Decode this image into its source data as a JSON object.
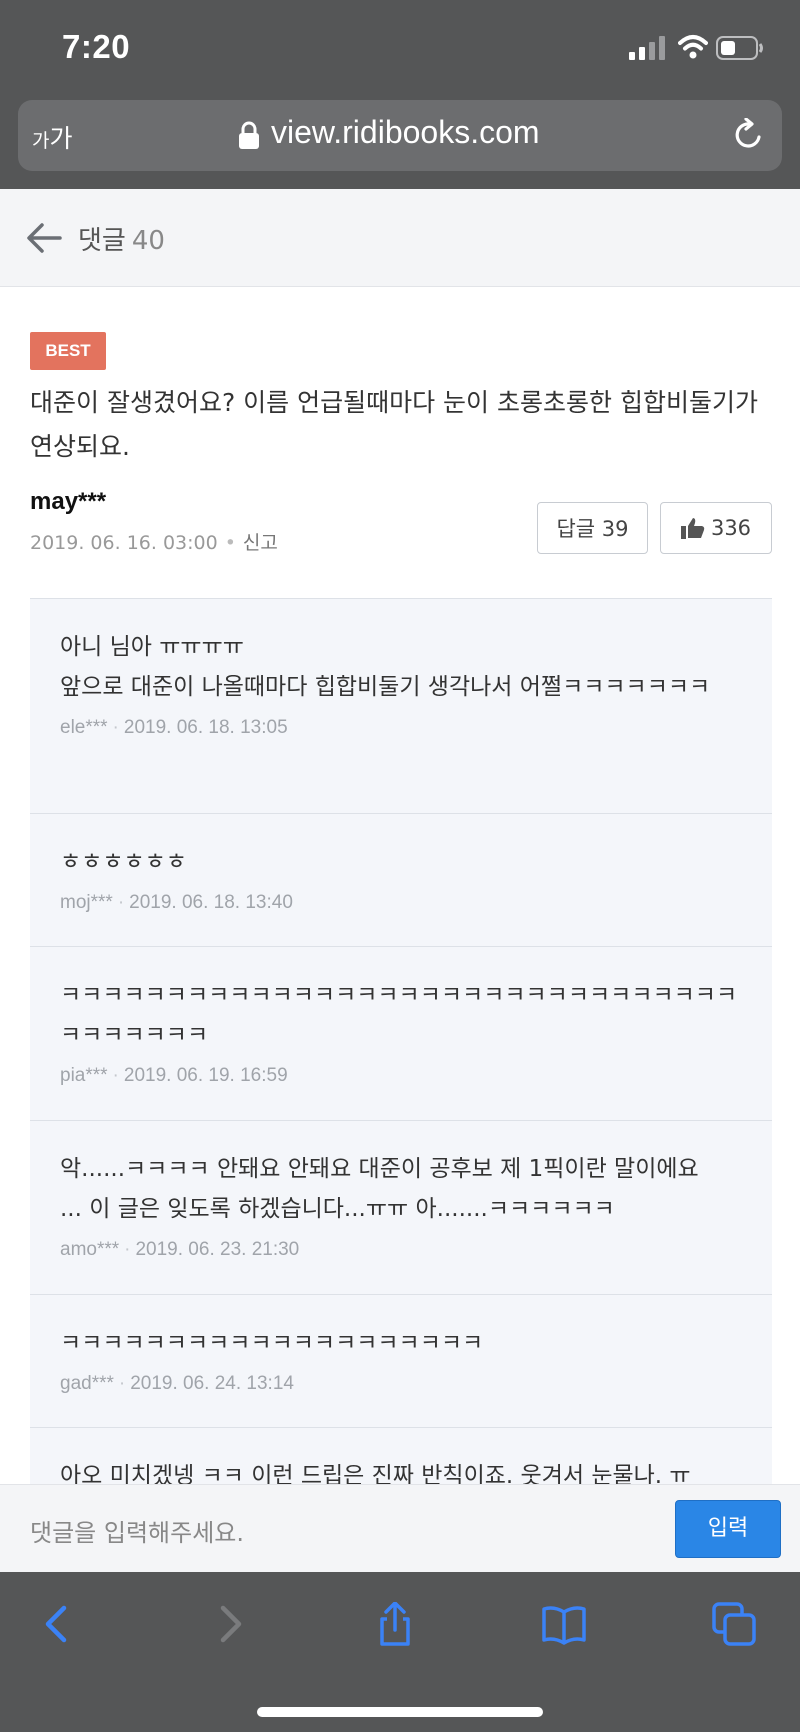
{
  "status_bar": {
    "time": "7:20"
  },
  "browser": {
    "font_size_label_small": "가",
    "font_size_label_large": "가",
    "url": "view.ridibooks.com"
  },
  "header": {
    "title": "댓글",
    "count": "40"
  },
  "best_comment": {
    "badge": "BEST",
    "text": "대준이 잘생겼어요? 이름 언급될때마다 눈이 초롱초롱한 힙합비둘기가 연상되요.",
    "user": "may***",
    "date": "2019. 06. 16. 03:00",
    "separator": "•",
    "report": "신고",
    "reply_label": "답글 39",
    "like_count": "336"
  },
  "replies": [
    {
      "text_line1": "아니 님아 ㅠㅠㅠㅠ",
      "text_line2": "앞으로 대준이 나올때마다 힙합비둘기 생각나서 어쩔ㅋㅋㅋㅋㅋㅋㅋ",
      "user": "ele***",
      "date": "2019. 06. 18. 13:05"
    },
    {
      "text_line1": "ㅎㅎㅎㅎㅎㅎ",
      "text_line2": "",
      "user": "moj***",
      "date": "2019. 06. 18. 13:40"
    },
    {
      "text_line1": "ㅋㅋㅋㅋㅋㅋㅋㅋㅋㅋㅋㅋㅋㅋㅋㅋㅋㅋㅋㅋㅋㅋㅋㅋㅋㅋㅋㅋㅋㅋㅋㅋㅋㅋㅋㅋㅋㅋㅋ",
      "text_line2": "",
      "user": "pia***",
      "date": "2019. 06. 19. 16:59"
    },
    {
      "text_line1": "악......ㅋㅋㅋㅋ 안돼요 안돼요 대준이 공후보 제 1픽이란 말이에요",
      "text_line2": "... 이 글은 잊도록 하겠습니다...ㅠㅠ 아.......ㅋㅋㅋㅋㅋㅋ",
      "user": "amo***",
      "date": "2019. 06. 23. 21:30"
    },
    {
      "text_line1": "ㅋㅋㅋㅋㅋㅋㅋㅋㅋㅋㅋㅋㅋㅋㅋㅋㅋㅋㅋㅋ",
      "text_line2": "",
      "user": "gad***",
      "date": "2019. 06. 24. 13:14"
    },
    {
      "text_line1": "아오 미치겠넹 ㅋㅋ 이런 드립은 진짜 반칙이죠. 웃겨서 눈물나. ㅠ",
      "text_line2": "",
      "user": "",
      "date": ""
    }
  ],
  "meta_separator": "·",
  "input": {
    "placeholder": "댓글을 입력해주세요.",
    "submit_label": "입력"
  },
  "colors": {
    "accent": "#2a86e6",
    "best_badge": "#e3735e",
    "chrome": "#555657"
  }
}
